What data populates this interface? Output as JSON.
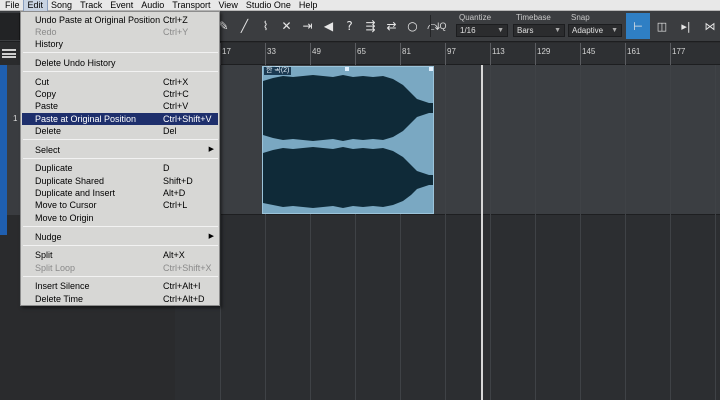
{
  "menubar": {
    "items": [
      "File",
      "Edit",
      "Song",
      "Track",
      "Event",
      "Audio",
      "Transport",
      "View",
      "Studio One",
      "Help"
    ],
    "active": "Edit"
  },
  "toolbar": {
    "iq_label": "IQ",
    "quantize": {
      "label": "Quantize",
      "value": "1/16"
    },
    "timebase": {
      "label": "Timebase",
      "value": "Bars"
    },
    "snap": {
      "label": "Snap",
      "value": "Adaptive"
    }
  },
  "track": {
    "number": "1"
  },
  "ruler": {
    "ticks": [
      "17",
      "33",
      "49",
      "65",
      "81",
      "97",
      "113",
      "129",
      "145",
      "161",
      "177"
    ]
  },
  "event": {
    "name": "한 곡(2)"
  },
  "edit_menu": {
    "items": [
      {
        "label": "Undo Paste at Original Position",
        "shortcut": "Ctrl+Z",
        "disabled": false
      },
      {
        "label": "Redo",
        "shortcut": "Ctrl+Y",
        "disabled": true
      },
      {
        "label": "History",
        "shortcut": "",
        "disabled": false
      },
      {
        "label": "Delete Undo History",
        "shortcut": "",
        "disabled": false
      },
      {
        "label": "Cut",
        "shortcut": "Ctrl+X",
        "disabled": false
      },
      {
        "label": "Copy",
        "shortcut": "Ctrl+C",
        "disabled": false
      },
      {
        "label": "Paste",
        "shortcut": "Ctrl+V",
        "disabled": false
      },
      {
        "label": "Paste at Original Position",
        "shortcut": "Ctrl+Shift+V",
        "disabled": false,
        "highlighted": true
      },
      {
        "label": "Delete",
        "shortcut": "Del",
        "disabled": false
      },
      {
        "label": "Select",
        "shortcut": "",
        "disabled": false,
        "submenu": true
      },
      {
        "label": "Duplicate",
        "shortcut": "D",
        "disabled": false
      },
      {
        "label": "Duplicate Shared",
        "shortcut": "Shift+D",
        "disabled": false
      },
      {
        "label": "Duplicate and Insert",
        "shortcut": "Alt+D",
        "disabled": false
      },
      {
        "label": "Move to Cursor",
        "shortcut": "Ctrl+L",
        "disabled": false
      },
      {
        "label": "Move to Origin",
        "shortcut": "",
        "disabled": false
      },
      {
        "label": "Nudge",
        "shortcut": "",
        "disabled": false,
        "submenu": true
      },
      {
        "label": "Split",
        "shortcut": "Alt+X",
        "disabled": false
      },
      {
        "label": "Split Loop",
        "shortcut": "Ctrl+Shift+X",
        "disabled": true
      },
      {
        "label": "Insert Silence",
        "shortcut": "Ctrl+Alt+I",
        "disabled": false
      },
      {
        "label": "Delete Time",
        "shortcut": "Ctrl+Alt+D",
        "disabled": false
      }
    ]
  },
  "colors": {
    "accent": "#2f7fc4",
    "menu_highlight": "#1e2f6c",
    "event_fill": "#7aa8c2",
    "waveform": "#0f2a38"
  },
  "icons": [
    "pencil-icon",
    "eraser-icon",
    "knife-icon",
    "mute-icon",
    "bend-icon",
    "listen-icon",
    "help-icon",
    "loop-icon",
    "zoom-icon"
  ]
}
